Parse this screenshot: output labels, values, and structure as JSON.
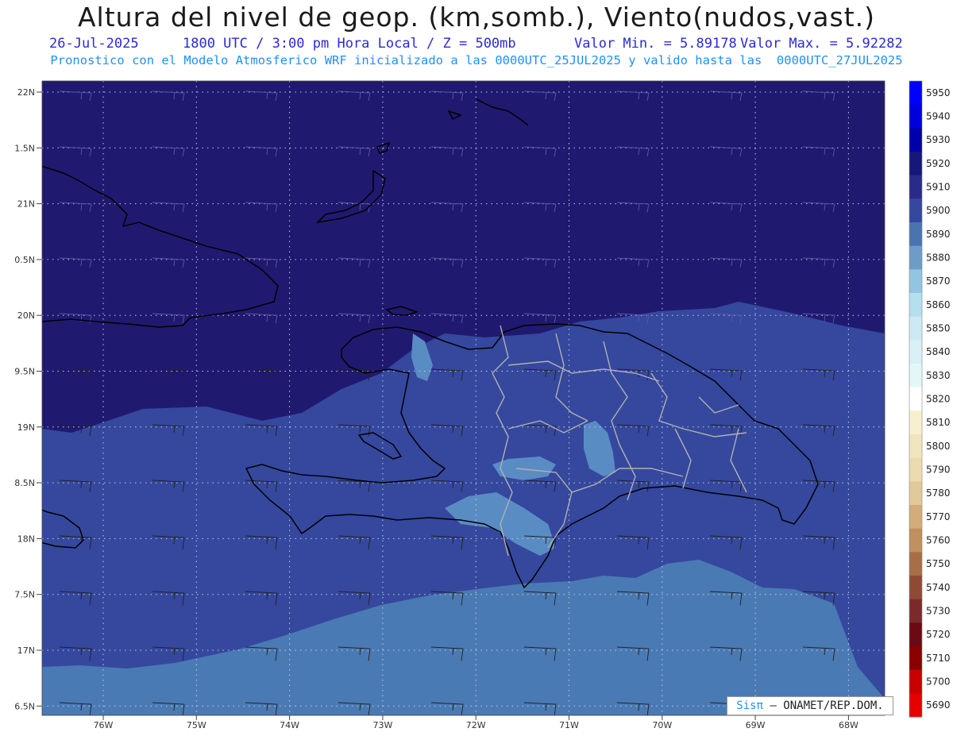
{
  "header": {
    "title": "Altura del nivel de geop. (km,somb.), Viento(nudos,vast.)",
    "date": "26-Jul-2025",
    "time": "1800 UTC / 3:00 pm Hora Local / Z = 500mb",
    "min": "Valor Min. = 5.89178",
    "max": "Valor Max. = 5.92282",
    "model_line": "Pronostico con el Modelo Atmosferico WRF inicializado a las 0000UTC_25JUL2025 y valido hasta las  0000UTC_27JUL2025"
  },
  "map": {
    "lat_labels": [
      "22N",
      "1.5N",
      "21N",
      "0.5N",
      "20N",
      "9.5N",
      "19N",
      "8.5N",
      "18N",
      "7.5N",
      "17N",
      "6.5N"
    ],
    "lon_labels": [
      "76W",
      "75W",
      "74W",
      "73W",
      "72W",
      "71W",
      "70W",
      "69W",
      "68W"
    ],
    "credit_brand": "Sisπ",
    "credit_text": "– ONAMET/REP.DOM."
  },
  "legend": {
    "values": [
      "5950",
      "5940",
      "5930",
      "5920",
      "5910",
      "5900",
      "5890",
      "5880",
      "5870",
      "5860",
      "5850",
      "5840",
      "5830",
      "5820",
      "5810",
      "5800",
      "5790",
      "5780",
      "5770",
      "5760",
      "5750",
      "5740",
      "5730",
      "5720",
      "5710",
      "5700",
      "5690"
    ],
    "colors": [
      "#0000ff",
      "#0000dd",
      "#0000aa",
      "#17177a",
      "#2a2a8a",
      "#35489e",
      "#4a74b0",
      "#6e9cc8",
      "#93c4e0",
      "#b4e0ee",
      "#cde9f3",
      "#d8f0f6",
      "#e3f7f9",
      "#ffffff",
      "#f7efcf",
      "#f1e5bf",
      "#ebdcb0",
      "#e2c99a",
      "#d4ac7a",
      "#c0915e",
      "#a86f47",
      "#8f4a36",
      "#7a2a2a",
      "#6b0a14",
      "#8b0000",
      "#c80000",
      "#e60000"
    ]
  },
  "colors": {
    "dark": "#1f1a70",
    "mid": "#35489e",
    "light": "#4a7ab4",
    "lighter": "#5a8cc4",
    "coast": "#000000",
    "border": "#b0b0b0"
  }
}
